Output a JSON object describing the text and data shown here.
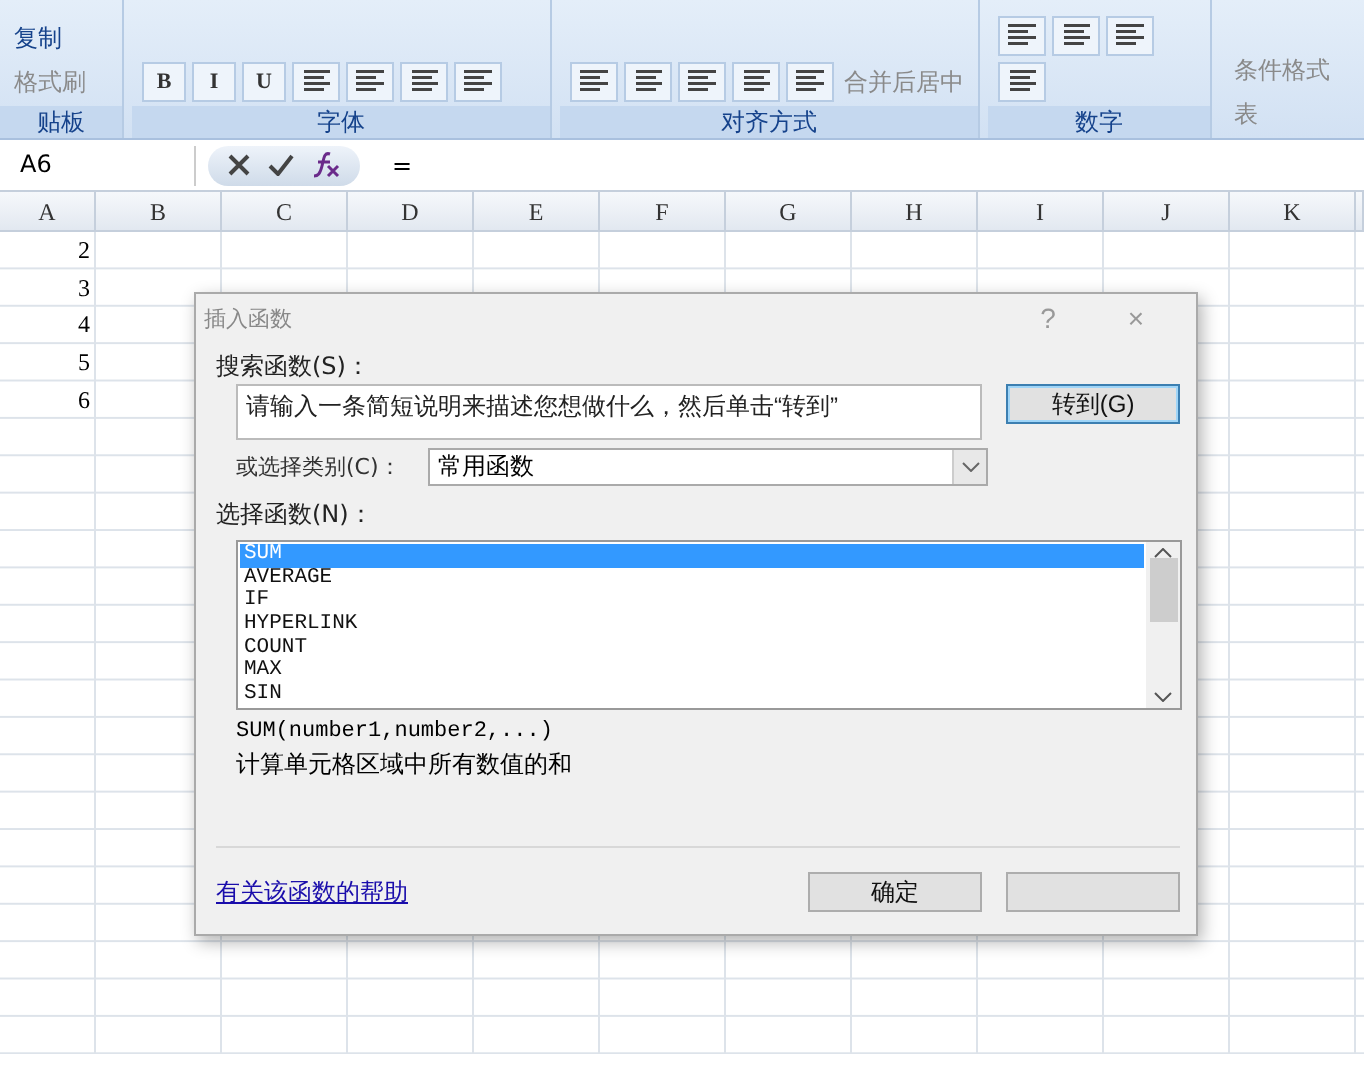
{
  "ribbon": {
    "groups": [
      {
        "label": "贴板",
        "items": [
          {
            "kind": "command",
            "label": "复制",
            "disabled": false
          },
          {
            "kind": "command",
            "label": "格式刷",
            "disabled": true
          }
        ]
      },
      {
        "label": "字体",
        "items": [
          {
            "kind": "format",
            "label": "B"
          },
          {
            "kind": "format",
            "label": "I"
          },
          {
            "kind": "format",
            "label": "U"
          },
          {
            "kind": "tool"
          },
          {
            "kind": "tool"
          },
          {
            "kind": "tool"
          },
          {
            "kind": "tool"
          }
        ]
      },
      {
        "label": "对齐方式",
        "items": [
          {
            "kind": "tool"
          },
          {
            "kind": "tool"
          },
          {
            "kind": "tool"
          },
          {
            "kind": "tool"
          },
          {
            "kind": "tool"
          },
          {
            "kind": "command",
            "label": "合并后居中",
            "disabled": true
          }
        ]
      },
      {
        "label": "数字",
        "items": [
          {
            "kind": "tool"
          },
          {
            "kind": "tool"
          },
          {
            "kind": "tool"
          },
          {
            "kind": "tool"
          }
        ]
      },
      {
        "items": [
          {
            "kind": "command",
            "label": "条件格式",
            "disabled": true
          },
          {
            "kind": "command",
            "label": "表",
            "disabled": true
          }
        ]
      }
    ]
  },
  "formula_bar": {
    "name_box": "A6",
    "formula": "="
  },
  "sheet": {
    "columns": [
      "A",
      "B",
      "C",
      "D",
      "E",
      "F",
      "G",
      "H",
      "I",
      "J",
      "K"
    ],
    "column_a_values": [
      "2",
      "3",
      "4",
      "5",
      "6"
    ]
  },
  "dialog": {
    "title": "插入函数",
    "help": "?",
    "close": "×",
    "search_label": "搜索函数(S)：",
    "search_value": "请输入一条简短说明来描述您想做什么，然后单击“转到”",
    "go_button": "转到(G)",
    "category_label": "或选择类别(C)：",
    "category_value": "常用函数",
    "list_label": "选择函数(N)：",
    "functions": [
      {
        "name": "SUM",
        "selected": true
      },
      {
        "name": "AVERAGE",
        "selected": false
      },
      {
        "name": "IF",
        "selected": false
      },
      {
        "name": "HYPERLINK",
        "selected": false
      },
      {
        "name": "COUNT",
        "selected": false
      },
      {
        "name": "MAX",
        "selected": false
      },
      {
        "name": "SIN",
        "selected": false
      }
    ],
    "signature": "SUM(number1,number2,...)",
    "description": "计算单元格区域中所有数值的和",
    "help_link": "有关该函数的帮助",
    "ok_button": "确定"
  }
}
